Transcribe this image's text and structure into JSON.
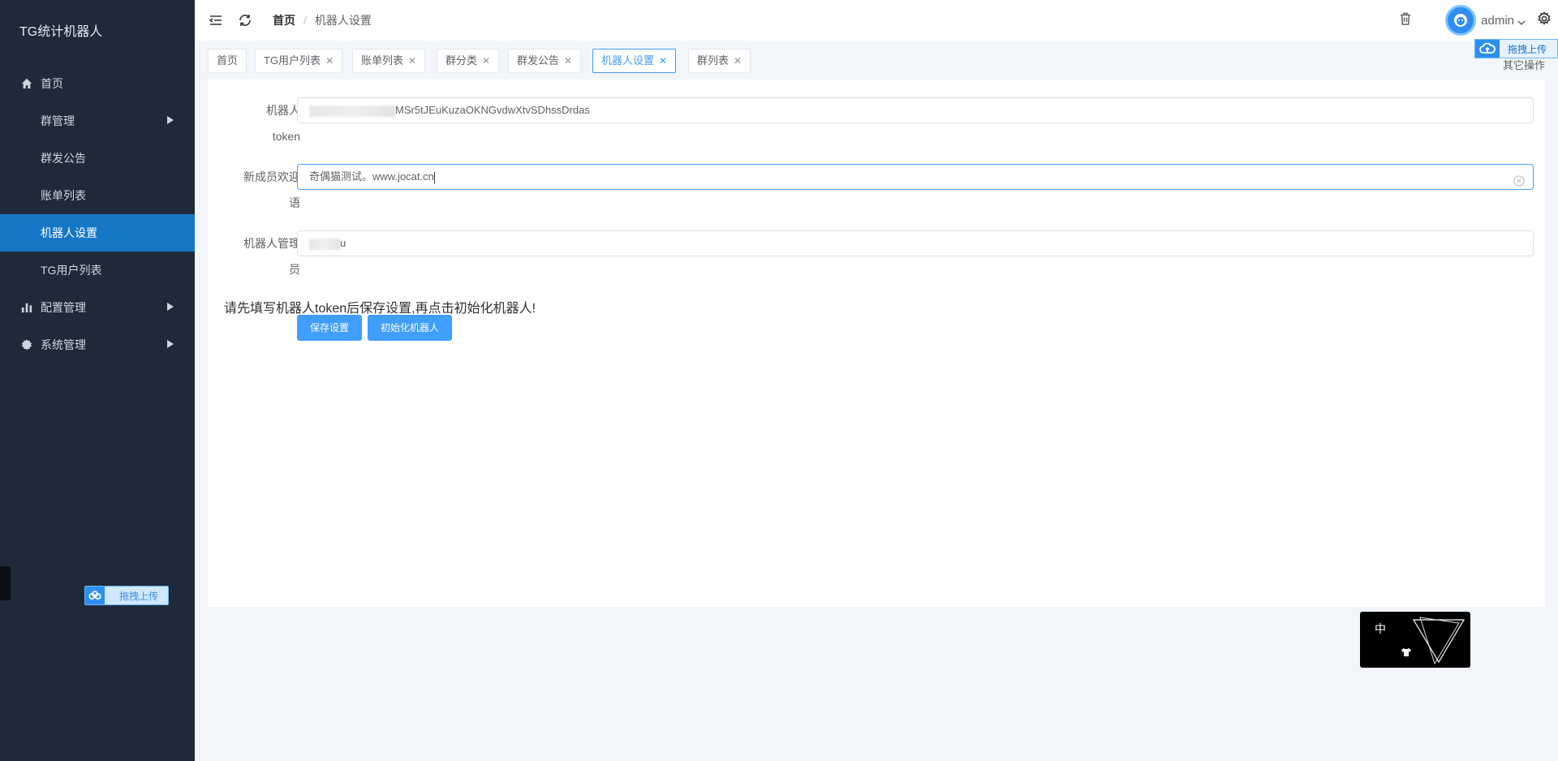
{
  "sidebar": {
    "title": "TG统计机器人",
    "items": [
      {
        "label": "首页",
        "icon": "home-icon",
        "active": false,
        "submenu": false
      },
      {
        "label": "群管理",
        "icon": "grid-icon",
        "active": false,
        "submenu": true
      },
      {
        "label": "群发公告",
        "icon": "grid-icon",
        "active": false,
        "submenu": false
      },
      {
        "label": "账单列表",
        "icon": "grid-icon",
        "active": false,
        "submenu": false
      },
      {
        "label": "机器人设置",
        "icon": "grid-icon",
        "active": true,
        "submenu": false
      },
      {
        "label": "TG用户列表",
        "icon": "grid-icon",
        "active": false,
        "submenu": false
      },
      {
        "label": "配置管理",
        "icon": "bar-chart-icon",
        "active": false,
        "submenu": true
      },
      {
        "label": "系统管理",
        "icon": "gear-icon",
        "active": false,
        "submenu": true
      }
    ],
    "upload_label": "拖拽上传"
  },
  "header": {
    "breadcrumb_home": "首页",
    "breadcrumb_sep": "/",
    "breadcrumb_current": "机器人设置",
    "username": "admin"
  },
  "tags": [
    {
      "label": "首页",
      "closable": false,
      "active": false
    },
    {
      "label": "TG用户列表",
      "closable": true,
      "active": false
    },
    {
      "label": "账单列表",
      "closable": true,
      "active": false
    },
    {
      "label": "群分类",
      "closable": true,
      "active": false
    },
    {
      "label": "群发公告",
      "closable": true,
      "active": false
    },
    {
      "label": "机器人设置",
      "closable": true,
      "active": true
    },
    {
      "label": "群列表",
      "closable": true,
      "active": false
    }
  ],
  "other_ops": "其它操作",
  "top_upload_label": "拖拽上传",
  "form": {
    "token_label_1": "机器人",
    "token_label_2": "token",
    "token_value": "MSr5tJEuKuzaOKNGvdwXtvSDhssDrdas",
    "welcome_label_1": "新成员欢迎",
    "welcome_label_2": "语",
    "welcome_value": "奇偶猫测试。www.jocat.cn",
    "admin_label_1": "机器人管理",
    "admin_label_2": "员",
    "admin_value": "u"
  },
  "notice": "请先填写机器人token后保存设置,再点击初始化机器人!",
  "buttons": {
    "save": "保存设置",
    "init": "初始化机器人"
  },
  "widget": {
    "lang": "中"
  },
  "colors": {
    "sidebar_bg": "#1e2a3a",
    "active_menu": "#1677c7",
    "primary": "#409eff"
  }
}
